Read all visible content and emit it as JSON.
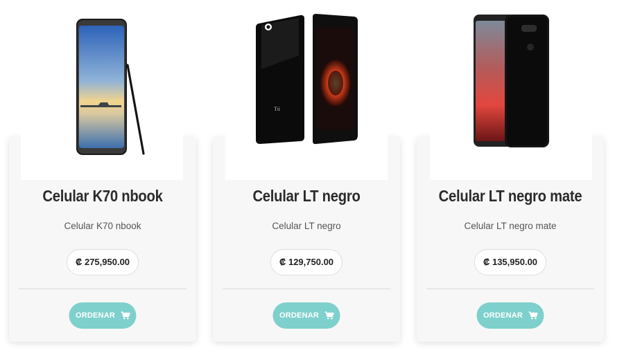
{
  "products": [
    {
      "title": "Celular K70 nbook",
      "description": "Celular K70 nbook",
      "price": "₡ 275,950.00",
      "button_label": "ORDENAR",
      "image_icon": "phone-with-stylus-image"
    },
    {
      "title": "Celular LT negro",
      "description": "Celular LT negro",
      "price": "₡ 129,750.00",
      "button_label": "ORDENAR",
      "image_icon": "black-phone-front-back-image"
    },
    {
      "title": "Celular LT negro mate",
      "description": "Celular LT negro mate",
      "price": "₡ 135,950.00",
      "button_label": "ORDENAR",
      "image_icon": "matte-black-phone-front-back-image"
    }
  ],
  "colors": {
    "button_bg": "#7ed0cc",
    "card_bg": "#f7f7f7",
    "title": "#2b2b2b"
  },
  "icons": {
    "cart": "cart-icon"
  }
}
